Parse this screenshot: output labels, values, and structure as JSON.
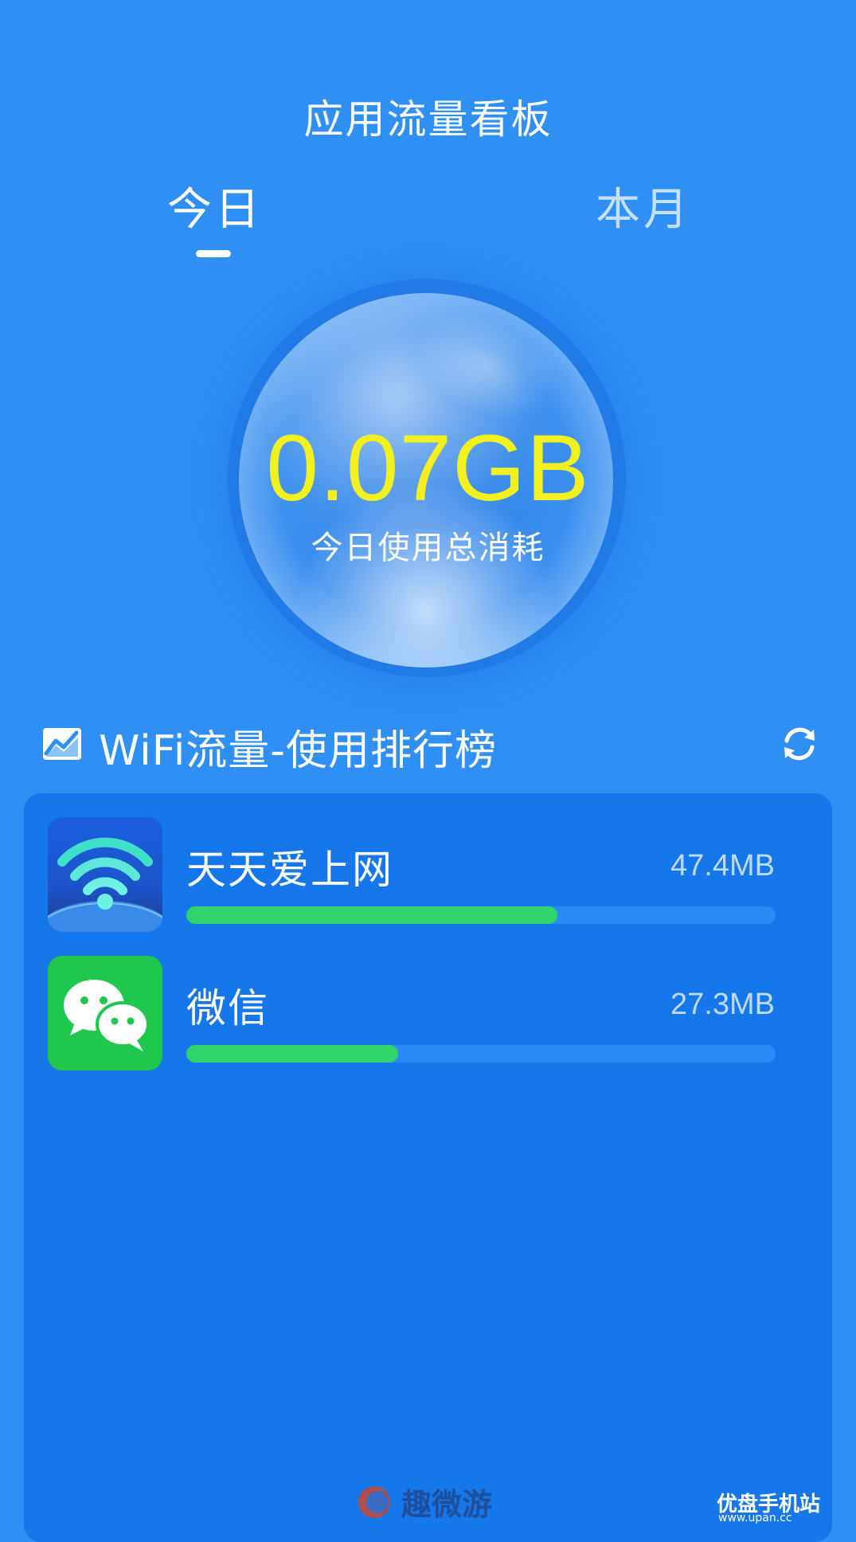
{
  "header": {
    "title": "应用流量看板"
  },
  "tabs": [
    {
      "label": "今日",
      "active": true
    },
    {
      "label": "本月",
      "active": false
    }
  ],
  "summary": {
    "total": "0.07GB",
    "caption": "今日使用总消耗"
  },
  "ranking": {
    "title": "WiFi流量-使用排行榜",
    "icons": {
      "leading": "trend-chart-icon",
      "trailing": "refresh-icon"
    }
  },
  "apps": [
    {
      "name": "天天爱上网",
      "usage": "47.4MB",
      "share": 0.63,
      "icon": "wifi-globe-icon"
    },
    {
      "name": "微信",
      "usage": "27.3MB",
      "share": 0.36,
      "icon": "wechat-icon"
    }
  ],
  "watermarks": {
    "left": "趣微游",
    "right": "优盘手机站",
    "right_sub": "www.upan.cc"
  },
  "colors": {
    "background": "#2f8ff3",
    "card": "#1677ea",
    "total_value": "#f2f01e",
    "bar_fill": "#2fd46a",
    "bar_track": "#2a8bf5"
  }
}
